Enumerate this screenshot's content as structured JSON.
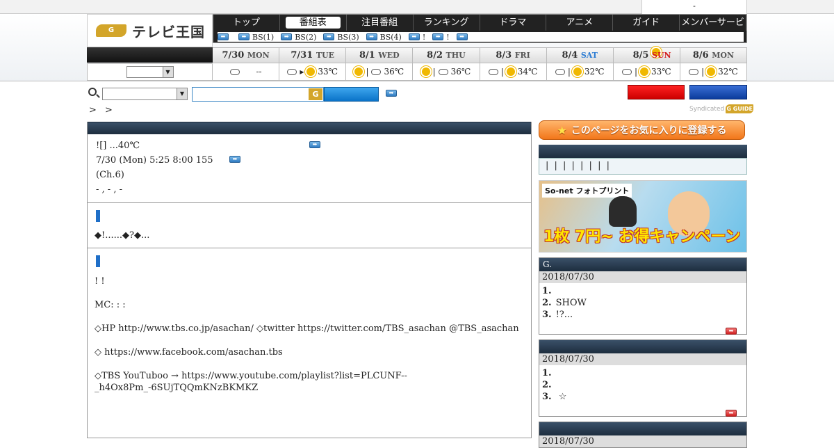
{
  "header": {
    "member_link": "-",
    "logo_badge": "G GUIDE",
    "logo_text": "テレビ王国"
  },
  "nav": {
    "tabs": [
      "トップ",
      "番組表",
      "注目番組",
      "ランキング",
      "ドラマ",
      "アニメ",
      "ガイド",
      "メンバーサービス"
    ],
    "active_tab": "番組表",
    "subs": [
      "",
      "BS(1)",
      "BS(2)",
      "BS(3)",
      "BS(4)",
      "!",
      "!",
      ""
    ]
  },
  "dates": [
    {
      "date": "7/30",
      "dow": "MON"
    },
    {
      "date": "7/31",
      "dow": "TUE"
    },
    {
      "date": "8/1",
      "dow": "WED"
    },
    {
      "date": "8/2",
      "dow": "THU"
    },
    {
      "date": "8/3",
      "dow": "FRI"
    },
    {
      "date": "8/4",
      "dow": "SAT"
    },
    {
      "date": "8/5",
      "dow": "SUN"
    },
    {
      "date": "8/6",
      "dow": "MON"
    }
  ],
  "weather": [
    {
      "icons": [
        "cloud"
      ],
      "sep": "",
      "temp": "--"
    },
    {
      "icons": [
        "cloud",
        "sun"
      ],
      "sep": "▸",
      "temp": "33℃"
    },
    {
      "icons": [
        "sun",
        "cloud"
      ],
      "sep": "|",
      "temp": "36℃"
    },
    {
      "icons": [
        "sun",
        "cloud"
      ],
      "sep": "|",
      "temp": "36℃"
    },
    {
      "icons": [
        "cloud",
        "sun"
      ],
      "sep": "|",
      "temp": "34℃"
    },
    {
      "icons": [
        "cloud",
        "sun"
      ],
      "sep": "|",
      "temp": "32℃"
    },
    {
      "icons": [
        "cloud",
        "sun"
      ],
      "sep": "|",
      "temp": "33℃"
    },
    {
      "icons": [
        "cloud",
        "sun"
      ],
      "sep": "|",
      "temp": "32℃"
    }
  ],
  "search": {
    "select_value": "",
    "input_value": "",
    "g_badge": "G"
  },
  "breadcrumb": "> >",
  "syndicated": "Syndicated",
  "syndicated_badge": "G GUIDE",
  "program": {
    "line1": "![] ...40℃",
    "line2": "7/30 (Mon) 5:25  8:00 155",
    "line3": "(Ch.6)",
    "line4": " -     ,  - ,  -"
  },
  "section1": {
    "text": "◆!......◆?◆..."
  },
  "section2": {
    "paragraphs": [
      "!  !",
      "MC:  :  :",
      "◇HP http://www.tbs.co.jp/asachan/    ◇twitter  https://twitter.com/TBS_asachan  @TBS_asachan",
      "◇ https://www.facebook.com/asachan.tbs",
      "◇TBS YouTuboo  → https://www.youtube.com/playlist?list=PLCUNF--_h4Ox8Pm_-6SUjTQQmKNzBKMKZ"
    ]
  },
  "sidebar": {
    "fav_button": "このページをお気に入りに登録する",
    "links": "| | | | | | | |",
    "banner": {
      "brand": "So-net フォトプリント",
      "promo": "1枚 7円~ お得キャンペーン"
    },
    "rank1": {
      "title": "G.",
      "date": "2018/07/30",
      "items": [
        {
          "num": "1.",
          "text": ""
        },
        {
          "num": "2.",
          "text": "SHOW"
        },
        {
          "num": "3.",
          "text": "!?..."
        }
      ]
    },
    "rank2": {
      "title": "",
      "date": "2018/07/30",
      "items": [
        {
          "num": "1.",
          "text": ""
        },
        {
          "num": "2.",
          "text": ""
        },
        {
          "num": "3.",
          "text": "    ☆"
        }
      ]
    },
    "rank3": {
      "title": "",
      "date": "2018/07/30"
    }
  },
  "colors": {
    "nav_bg": "#222222",
    "section_header": "#1d2d3e",
    "accent_blue": "#1f6fc8",
    "accent_orange": "#f2761a",
    "sat_color": "#2a7bd3",
    "sun_color": "#d31a1a"
  }
}
